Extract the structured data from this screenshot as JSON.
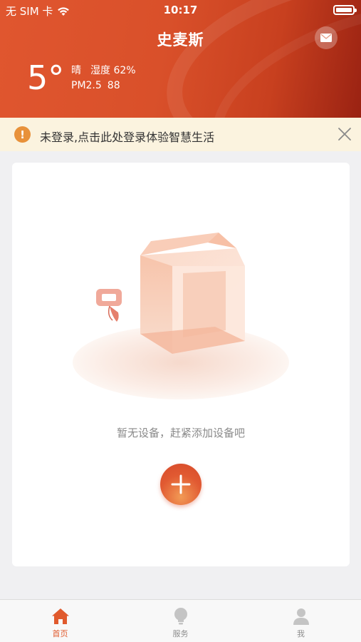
{
  "status_bar": {
    "carrier": "无 SIM 卡",
    "time": "10:17"
  },
  "header": {
    "title": "史麦斯",
    "temperature": "5°",
    "weather": "晴",
    "humidity_label": "湿度",
    "humidity_value": "62%",
    "pm25_label": "PM2.5",
    "pm25_value": "88",
    "background_color": "#d9502a",
    "mail_icon": "mail-icon"
  },
  "login_banner": {
    "text": "未登录,点击此处登录体验智慧生活",
    "warning_icon_glyph": "!",
    "background_color": "#fbf3df",
    "icon_color": "#e8913a"
  },
  "device_card": {
    "empty_text": "暂无设备，赶紧添加设备吧",
    "add_button_icon": "plus-icon",
    "accent_color": "#e15a32"
  },
  "tab_bar": {
    "tabs": [
      {
        "label": "首页",
        "icon": "home-icon",
        "active": true
      },
      {
        "label": "服务",
        "icon": "lightbulb-icon",
        "active": false
      },
      {
        "label": "我",
        "icon": "person-icon",
        "active": false
      }
    ],
    "active_color": "#e05a2d",
    "inactive_color": "#8e8e8e"
  }
}
